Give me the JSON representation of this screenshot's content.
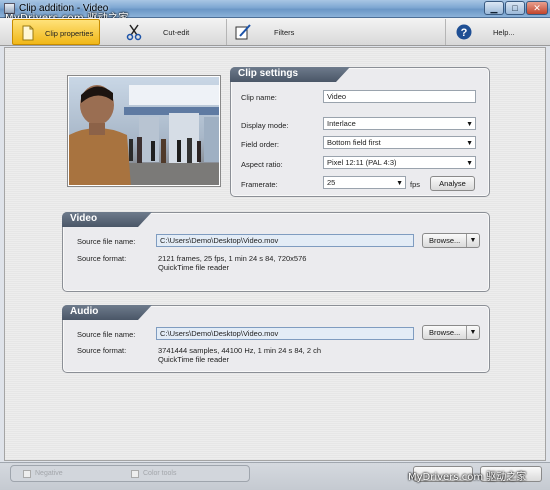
{
  "window": {
    "title": "Clip addition - Video"
  },
  "watermark": {
    "top": "MyDrivers.com 驱动之家",
    "bottom": "MyDrivers.com 驱动之家"
  },
  "toolbar": {
    "tabs": [
      {
        "label": "Clip properties",
        "icon": "document-icon",
        "active": true
      },
      {
        "label": "Cut-edit",
        "icon": "scissors-icon",
        "active": false
      },
      {
        "label": "Filters",
        "icon": "pen-icon",
        "active": false
      },
      {
        "label": "Help...",
        "icon": "help-icon",
        "active": false
      }
    ]
  },
  "clip_settings": {
    "header": "Clip settings",
    "clip_name_label": "Clip name:",
    "clip_name_value": "Video",
    "display_mode_label": "Display mode:",
    "display_mode_value": "Interlace",
    "field_order_label": "Field order:",
    "field_order_value": "Bottom field first",
    "aspect_ratio_label": "Aspect ratio:",
    "aspect_ratio_value": "Pixel 12:11 (PAL 4:3)",
    "framerate_label": "Framerate:",
    "framerate_value": "25",
    "framerate_unit": "fps",
    "analyse_button": "Analyse"
  },
  "video": {
    "header": "Video",
    "source_file_label": "Source file name:",
    "source_file_value": "C:\\Users\\Demo\\Desktop\\Video.mov",
    "browse_button": "Browse...",
    "source_format_label": "Source format:",
    "source_format_line1": "2121  frames,  25  fps,  1 min 24 s 84,  720x576",
    "source_format_line2": "QuickTime file reader"
  },
  "audio": {
    "header": "Audio",
    "source_file_label": "Source file name:",
    "source_file_value": "C:\\Users\\Demo\\Desktop\\Video.mov",
    "browse_button": "Browse...",
    "source_format_label": "Source format:",
    "source_format_line1": "3741444  samples,  44100  Hz,  1 min 24 s 84,  2 ch",
    "source_format_line2": "QuickTime file reader"
  },
  "bottom": {
    "checkbox1_label": "Negative",
    "checkbox2_label": "Color tools"
  },
  "colors": {
    "active_tab": "#f5c22a",
    "panel_header": "#556274",
    "path_field": "#e3ecf6"
  }
}
